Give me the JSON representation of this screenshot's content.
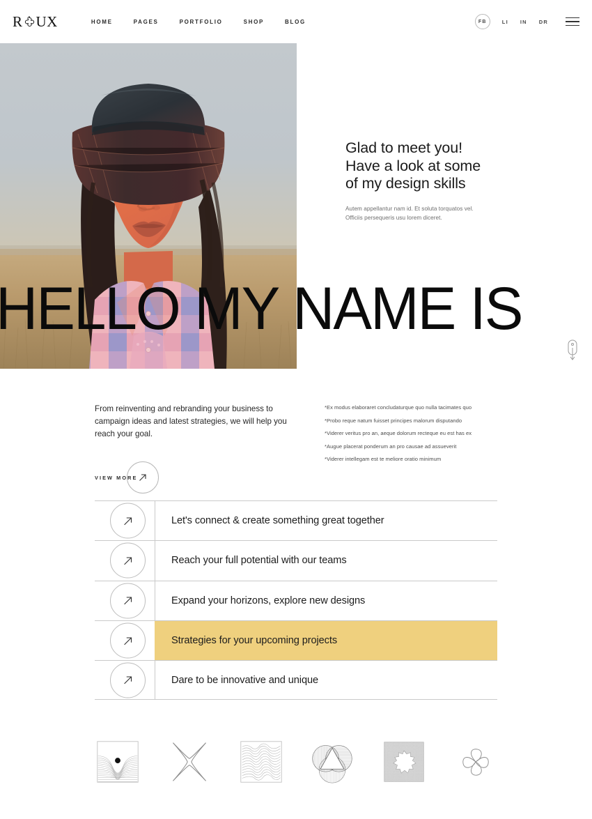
{
  "header": {
    "logo": {
      "left": "R",
      "right": "UX",
      "mark_icon": "quatrefoil-icon"
    },
    "nav": [
      {
        "label": "HOME"
      },
      {
        "label": "PAGES"
      },
      {
        "label": "PORTFOLIO"
      },
      {
        "label": "SHOP"
      },
      {
        "label": "BLOG"
      }
    ],
    "social": [
      {
        "label": "FB",
        "circled": true
      },
      {
        "label": "LI",
        "circled": false
      },
      {
        "label": "IN",
        "circled": false
      },
      {
        "label": "DR",
        "circled": false
      }
    ],
    "menu_icon": "hamburger-menu-icon"
  },
  "hero": {
    "photo_alt": "portrait-woman-bucket-hat",
    "title_line1": "Glad to meet you!",
    "title_line2": "Have a look at some",
    "title_line3": "of my design skills",
    "sub_line1": "Autem appellantur nam id. Et soluta torquatos vel.",
    "sub_line2": "Officiis persequeris usu lorem diceret.",
    "big_title": "HELLO MY NAME IS",
    "scroll_icon": "scroll-mouse-icon"
  },
  "intro": {
    "paragraph": "From reinventing and rebranding your business to campaign ideas and latest strategies, we will help you reach your goal.",
    "view_more_label": "VIEW MORE",
    "view_more_icon": "arrow-up-right-icon",
    "bullets": [
      "*Ex modus elaboraret concludaturque quo nulla tacimates quo",
      "*Probo reque natum fuisset principes malorum disputando",
      "*Viderer veritus pro an, aeque dolorum recteque eu est has ex",
      "*Augue placerat ponderum an pro causae ad assueverit",
      "*Viderer intellegam est te meliore oratio minimum"
    ]
  },
  "list": {
    "highlight_color": "#efd07e",
    "rows": [
      {
        "label": "Let's connect & create something great together",
        "highlighted": false,
        "icon": "arrow-up-right-icon"
      },
      {
        "label": "Reach your full potential with our teams",
        "highlighted": false,
        "icon": "arrow-up-right-icon"
      },
      {
        "label": "Expand your horizons, explore new designs",
        "highlighted": false,
        "icon": "arrow-up-right-icon"
      },
      {
        "label": "Strategies for your upcoming projects",
        "highlighted": true,
        "icon": "arrow-up-right-icon"
      },
      {
        "label": "Dare to be innovative and unique",
        "highlighted": false,
        "icon": "arrow-up-right-icon"
      }
    ]
  },
  "strip": {
    "graphics": [
      {
        "name": "gravity-well-dot-graphic"
      },
      {
        "name": "four-point-star-graphic"
      },
      {
        "name": "wave-lines-graphic"
      },
      {
        "name": "triangle-circle-moire-graphic"
      },
      {
        "name": "square-burst-graphic"
      },
      {
        "name": "four-petal-flower-graphic"
      }
    ]
  }
}
